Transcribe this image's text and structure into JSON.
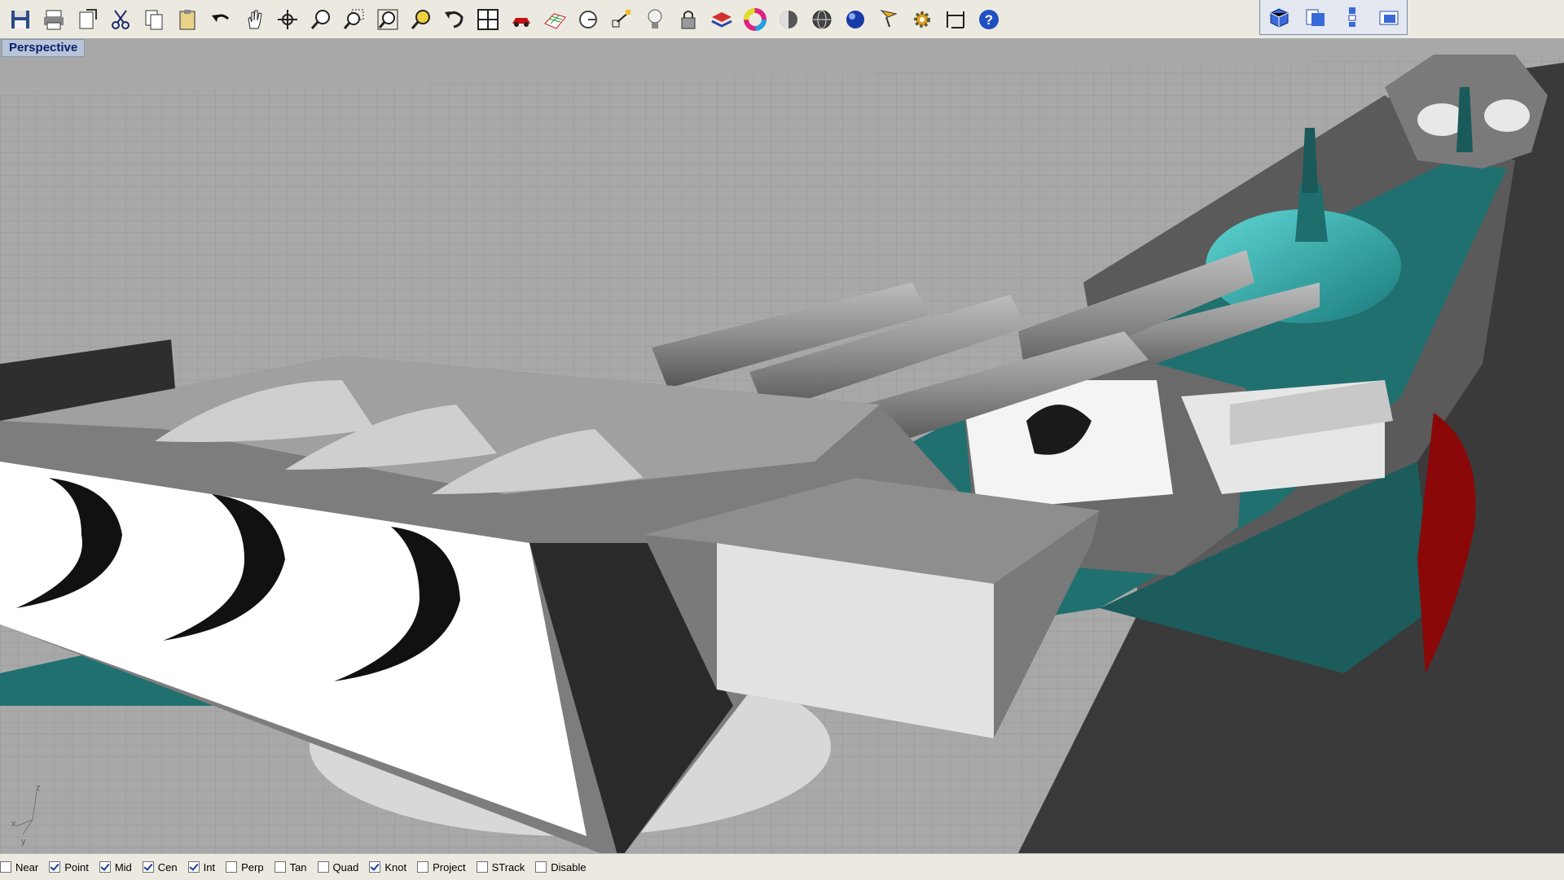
{
  "toolbar": {
    "left_icons": [
      "save-icon",
      "print-icon",
      "import-icon",
      "cut-icon",
      "copy-icon",
      "paste-icon",
      "undo-icon",
      "pan-hand-icon",
      "rotate-view-icon",
      "zoom-icon",
      "zoom-window-icon",
      "zoom-extents-icon",
      "zoom-selected-icon",
      "undo-view-icon",
      "four-viewports-icon",
      "car-icon",
      "grid-icon",
      "circle-tool-icon",
      "osnap-icon",
      "lightbulb-icon",
      "lock-icon",
      "layer-icon",
      "color-wheel-icon",
      "shaded-sphere-icon",
      "wireframe-sphere-icon",
      "rendered-sphere-icon",
      "pointer-icon",
      "settings-gear-icon",
      "dimension-icon",
      "help-icon"
    ],
    "right_icons": [
      "view-3d-box-icon",
      "view-front-icon",
      "view-split-icon",
      "view-top-icon"
    ]
  },
  "viewport": {
    "title": "Perspective",
    "axis_labels": {
      "z": "z",
      "x": "x",
      "y": "y"
    },
    "colors": {
      "background": "#a6a6a6",
      "grid": "#959595",
      "teal": "#217070",
      "light_teal": "#3cb8b8",
      "turret_white": "#ffffff",
      "turret_grey": "#8c8c8c",
      "dark": "#404040",
      "red": "#9a0a0a"
    }
  },
  "osnap": {
    "items": [
      {
        "label": "Near",
        "checked": false
      },
      {
        "label": "Point",
        "checked": true
      },
      {
        "label": "Mid",
        "checked": true
      },
      {
        "label": "Cen",
        "checked": true
      },
      {
        "label": "Int",
        "checked": true
      },
      {
        "label": "Perp",
        "checked": false
      },
      {
        "label": "Tan",
        "checked": false
      },
      {
        "label": "Quad",
        "checked": false
      },
      {
        "label": "Knot",
        "checked": true
      },
      {
        "label": "Project",
        "checked": false
      },
      {
        "label": "STrack",
        "checked": false
      },
      {
        "label": "Disable",
        "checked": false
      }
    ]
  }
}
